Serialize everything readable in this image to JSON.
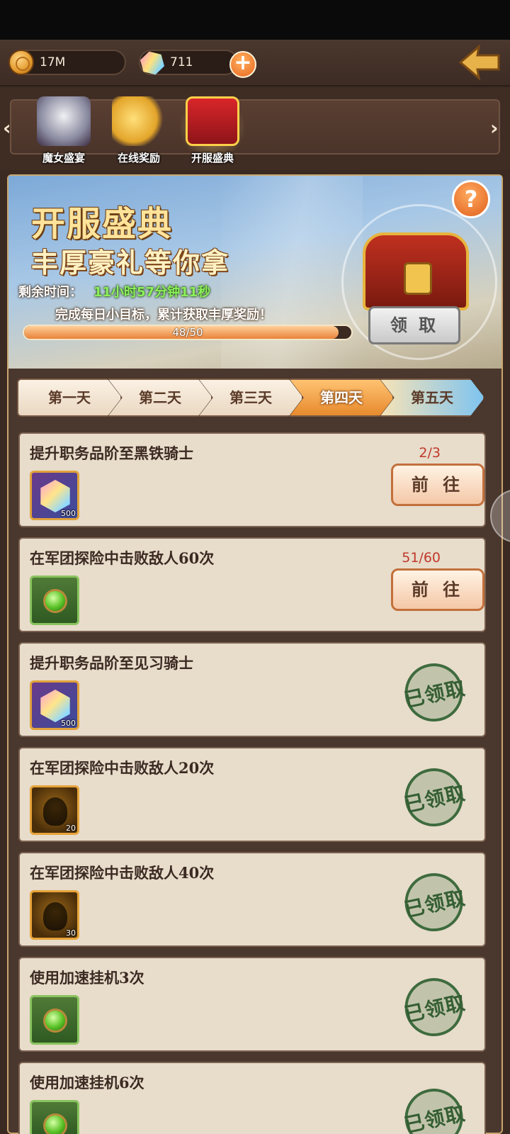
{
  "resources": {
    "gold": "17M",
    "gems": "711"
  },
  "tabs": [
    {
      "label": "魔女盛宴"
    },
    {
      "label": "在线奖励"
    },
    {
      "label": "开服盛典"
    }
  ],
  "banner": {
    "title": "开服盛典",
    "subtitle": "丰厚豪礼等你拿",
    "time_label": "剩余时间：",
    "time_value": "11小时57分钟11秒",
    "description": "完成每日小目标，累计获取丰厚奖励！",
    "progress_text": "48/50",
    "progress_fraction": 0.96,
    "claim_label": "领 取",
    "help": "?"
  },
  "days": [
    "第一天",
    "第二天",
    "第三天",
    "第四天",
    "第五天"
  ],
  "tasks": [
    {
      "title": "提升职务品阶至黑铁骑士",
      "progress": "2/3",
      "reward_qty": "500",
      "action": "前 往"
    },
    {
      "title": "在军团探险中击败敌人60次",
      "progress": "51/60",
      "reward_qty": "",
      "action": "前 往"
    },
    {
      "title": "提升职务品阶至见习骑士",
      "reward_qty": "500",
      "status": "已领取"
    },
    {
      "title": "在军团探险中击败敌人20次",
      "reward_qty": "20",
      "status": "已领取"
    },
    {
      "title": "在军团探险中击败敌人40次",
      "reward_qty": "30",
      "status": "已领取"
    },
    {
      "title": "使用加速挂机3次",
      "reward_qty": "",
      "status": "已领取"
    },
    {
      "title": "使用加速挂机6次",
      "reward_qty": "",
      "status": "已领取"
    }
  ],
  "colors": {
    "accent_orange": "#e8661e",
    "progress_red": "#c0392b",
    "stamp_green": "#355e33"
  }
}
